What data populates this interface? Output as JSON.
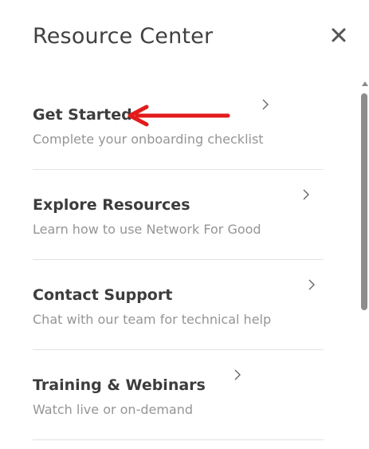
{
  "header": {
    "title": "Resource Center",
    "close_icon": "close-icon"
  },
  "items": [
    {
      "title": "Get Started",
      "subtitle": "Complete your onboarding checklist"
    },
    {
      "title": "Explore Resources",
      "subtitle": "Learn how to use Network For Good"
    },
    {
      "title": "Contact Support",
      "subtitle": "Chat with our team for technical help"
    },
    {
      "title": "Training & Webinars",
      "subtitle": "Watch live or on-demand"
    }
  ],
  "annotation": {
    "icon": "red-arrow-icon",
    "color": "#e31b1b"
  },
  "colors": {
    "title": "#404040",
    "subtitle": "#959595",
    "divider": "#e2e2e2",
    "scroll_thumb": "#8d8d8d"
  }
}
